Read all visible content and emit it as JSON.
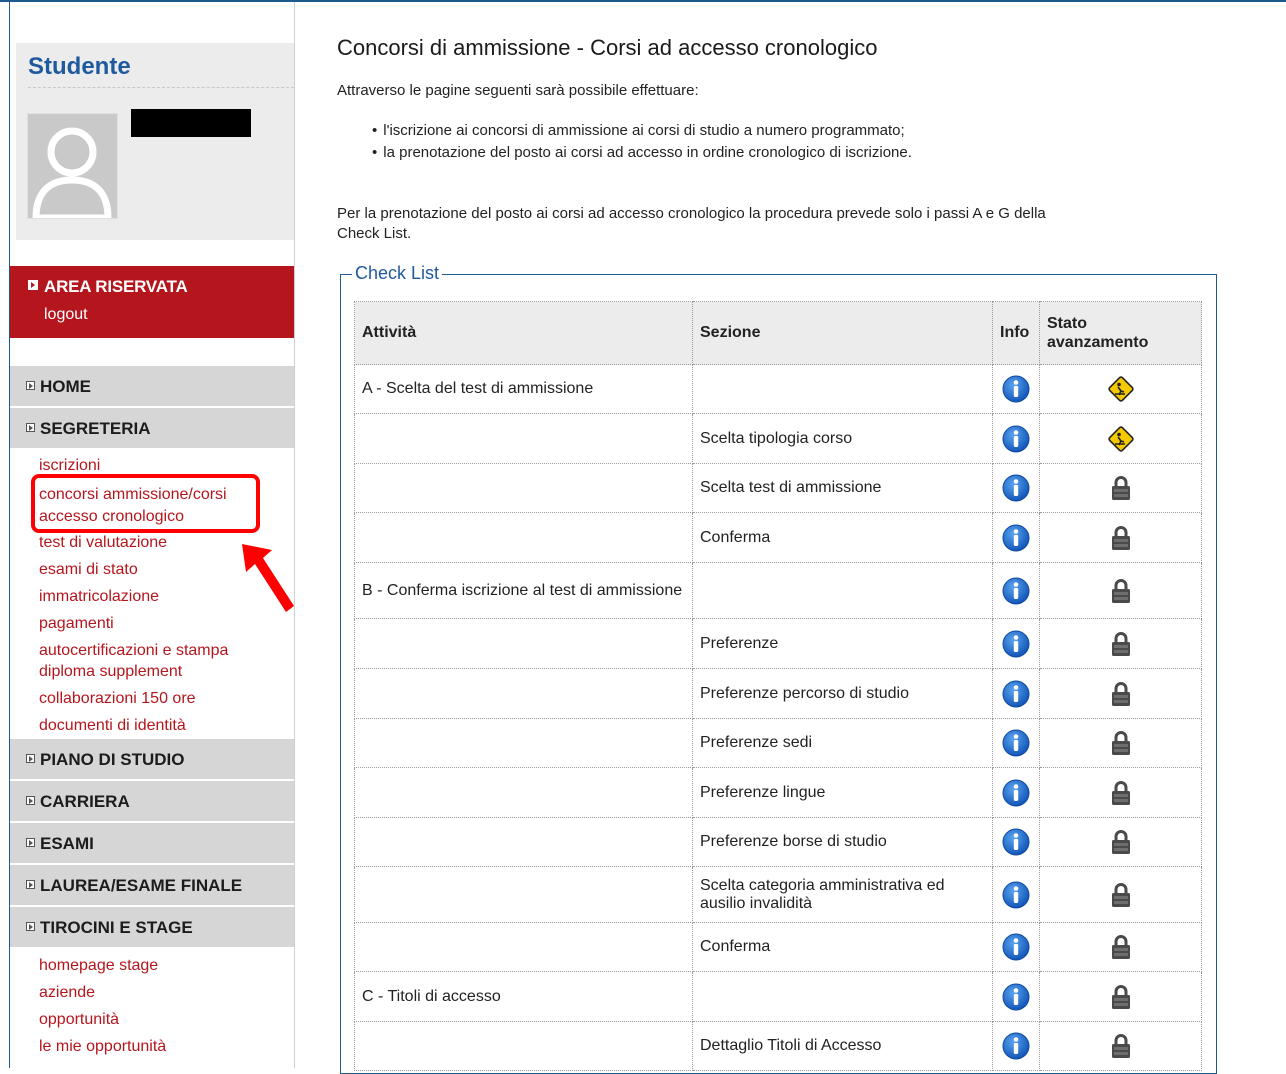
{
  "sidebar": {
    "title": "Studente",
    "area": {
      "title": "AREA RISERVATA",
      "logout": "logout"
    },
    "menu": {
      "home": "HOME",
      "segreteria": "SEGRETERIA",
      "segreteria_items": [
        "iscrizioni",
        "concorsi ammissione/corsi",
        "accesso cronologico",
        "test di valutazione",
        "esami di stato",
        "immatricolazione",
        "pagamenti",
        "autocertificazioni e stampa",
        "diploma supplement",
        "collaborazioni 150 ore",
        "documenti di identità"
      ],
      "piano": "PIANO DI STUDIO",
      "carriera": "CARRIERA",
      "esami": "ESAMI",
      "laurea": "LAUREA/ESAME FINALE",
      "tirocini": "TIROCINI E STAGE",
      "tirocini_items": [
        "homepage stage",
        "aziende",
        "opportunità",
        "le mie opportunità"
      ]
    }
  },
  "main": {
    "title": "Concorsi di ammissione - Corsi ad accesso cronologico",
    "intro": "Attraverso le pagine seguenti sarà possibile effettuare:",
    "bullets": [
      "l'iscrizione ai concorsi di ammissione ai corsi di studio a numero programmato;",
      "la prenotazione del posto ai corsi ad accesso in ordine cronologico di iscrizione."
    ],
    "note_line1": "Per la prenotazione del posto ai corsi ad accesso cronologico la procedura prevede solo i passi A e G della",
    "note_line2": "Check List.",
    "checklist": {
      "legend": "Check List",
      "headers": {
        "attivita": "Attività",
        "sezione": "Sezione",
        "info": "Info",
        "stato_1": "Stato",
        "stato_2": "avanzamento"
      },
      "rows": [
        {
          "attivita": "A - Scelta del test di ammissione",
          "sezione": "",
          "stato": "in-progress"
        },
        {
          "attivita": "",
          "sezione": "Scelta tipologia corso",
          "stato": "in-progress"
        },
        {
          "attivita": "",
          "sezione": "Scelta test di ammissione",
          "stato": "locked"
        },
        {
          "attivita": "",
          "sezione": "Conferma",
          "stato": "locked"
        },
        {
          "attivita": "B - Conferma iscrizione al test di ammissione",
          "sezione": "",
          "stato": "locked"
        },
        {
          "attivita": "",
          "sezione": "Preferenze",
          "stato": "locked"
        },
        {
          "attivita": "",
          "sezione": "Preferenze percorso di studio",
          "stato": "locked"
        },
        {
          "attivita": "",
          "sezione": "Preferenze sedi",
          "stato": "locked"
        },
        {
          "attivita": "",
          "sezione": "Preferenze lingue",
          "stato": "locked"
        },
        {
          "attivita": "",
          "sezione": "Preferenze borse di studio",
          "stato": "locked"
        },
        {
          "attivita": "",
          "sezione": "Scelta categoria amministrativa ed ausilio invalidità",
          "stato": "locked"
        },
        {
          "attivita": "",
          "sezione": "Conferma",
          "stato": "locked"
        },
        {
          "attivita": "C - Titoli di accesso",
          "sezione": "",
          "stato": "locked"
        },
        {
          "attivita": "",
          "sezione": "Dettaglio Titoli di Accesso",
          "stato": "locked"
        }
      ]
    }
  },
  "colors": {
    "brand_red": "#b5161d",
    "brand_blue": "#1f5a9e",
    "highlight": "#ff0000"
  }
}
